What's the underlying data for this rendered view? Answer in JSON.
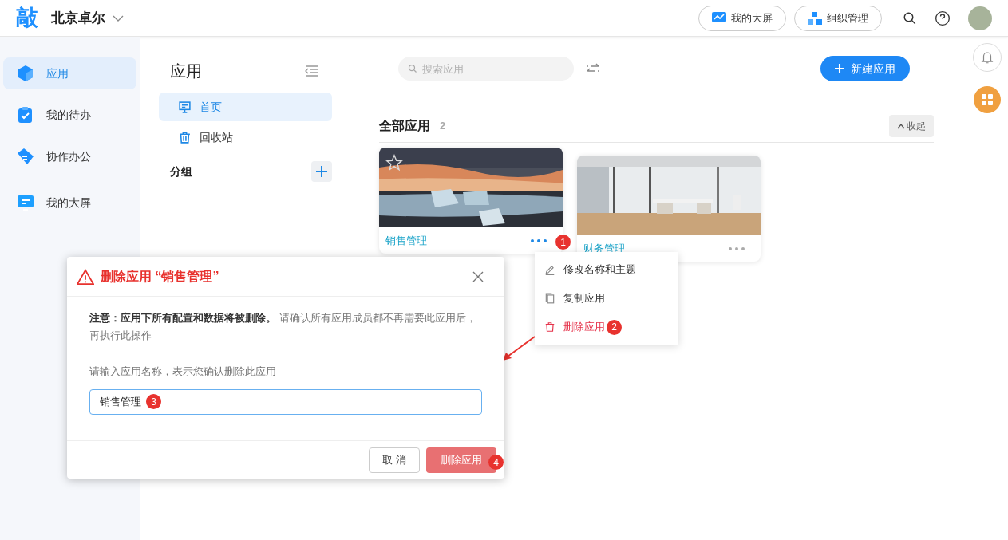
{
  "header": {
    "logo": "敲",
    "org": "北京卓尔",
    "buttons": [
      {
        "label": "我的大屏",
        "kind": "screen"
      },
      {
        "label": "组织管理",
        "kind": "org"
      }
    ]
  },
  "nav": [
    {
      "label": "应用",
      "selected": true,
      "kind": "cube"
    },
    {
      "label": "我的待办",
      "selected": false,
      "kind": "todo"
    },
    {
      "label": "协作办公",
      "selected": false,
      "kind": "tag"
    },
    {
      "label": "我的大屏",
      "selected": false,
      "kind": "screen"
    }
  ],
  "panel": {
    "title": "应用",
    "items": [
      {
        "label": "首页",
        "selected": true,
        "kind": "home"
      },
      {
        "label": "回收站",
        "selected": false,
        "kind": "trash"
      }
    ],
    "group_label": "分组"
  },
  "main": {
    "search": {
      "placeholder": "搜索应用"
    },
    "new_button": "新建应用",
    "section_title": "全部应用",
    "count": "2",
    "collapse": "收起",
    "cards": [
      {
        "name": "销售管理",
        "kind": "ice"
      },
      {
        "name": "财务管理",
        "kind": "office"
      }
    ]
  },
  "menu": [
    {
      "label": "修改名称和主题",
      "kind": "edit",
      "danger": false
    },
    {
      "label": "复制应用",
      "kind": "copy",
      "danger": false
    },
    {
      "label": "删除应用",
      "kind": "delete",
      "danger": true
    }
  ],
  "dialog": {
    "title": "删除应用 “销售管理”",
    "note": "**注意：应用下所有配置和数据将被删除。** 请确认所有应用成员都不再需要此应用后，再执行此操作",
    "prompt": "请输入应用名称，表示您确认删除此应用",
    "value": "销售管理",
    "cancel": "取 消",
    "confirm": "删除应用"
  },
  "markers": [
    "1",
    "2",
    "3",
    "4"
  ]
}
